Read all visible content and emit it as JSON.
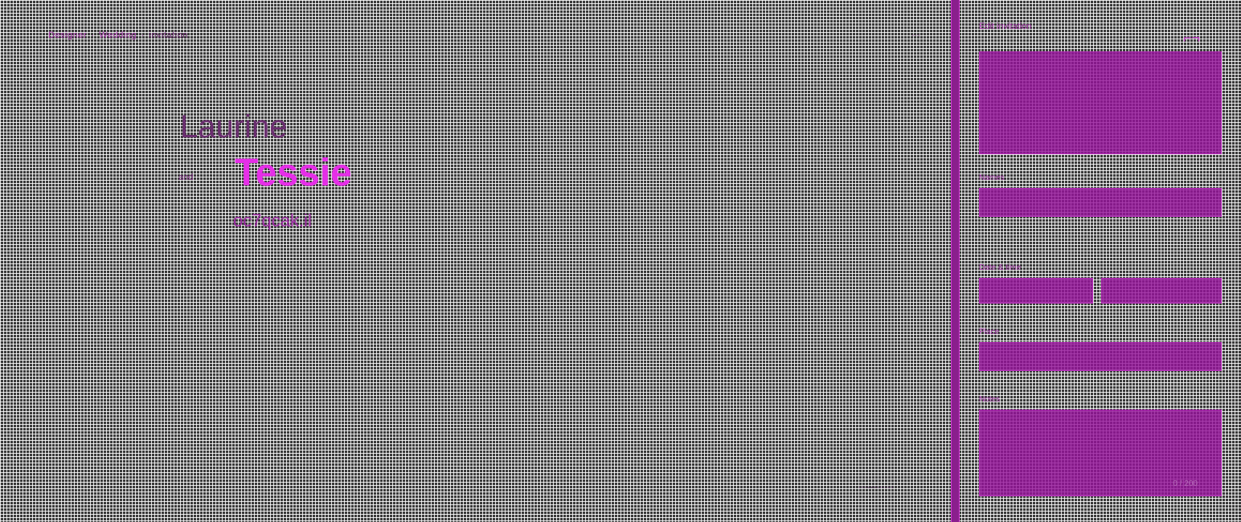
{
  "breadcrumb": {
    "first": "Designer",
    "second": "Wedding",
    "tail": "invitation"
  },
  "canvas": {
    "name_first": "Laurine",
    "name_and": "and",
    "name_second": "Tessie",
    "code": "oc7qcak.il",
    "corner_label": "···",
    "footer_text": "············"
  },
  "panel": {
    "title": "Edit invitation",
    "close_icon": "close-icon",
    "fields": {
      "message_label": "",
      "message_value": "",
      "name_label": "Names",
      "name_value": "",
      "hint_text": "",
      "date_label": "Date & time",
      "date_value": "",
      "time_value": "",
      "place_label": "Place",
      "place_value": "",
      "notes_label": "Notes",
      "notes_value": ""
    },
    "counter": "0 / 200"
  },
  "colors": {
    "accent": "#e62ee8",
    "panel_fill": "#96149b",
    "background": "#3a3a3a"
  }
}
